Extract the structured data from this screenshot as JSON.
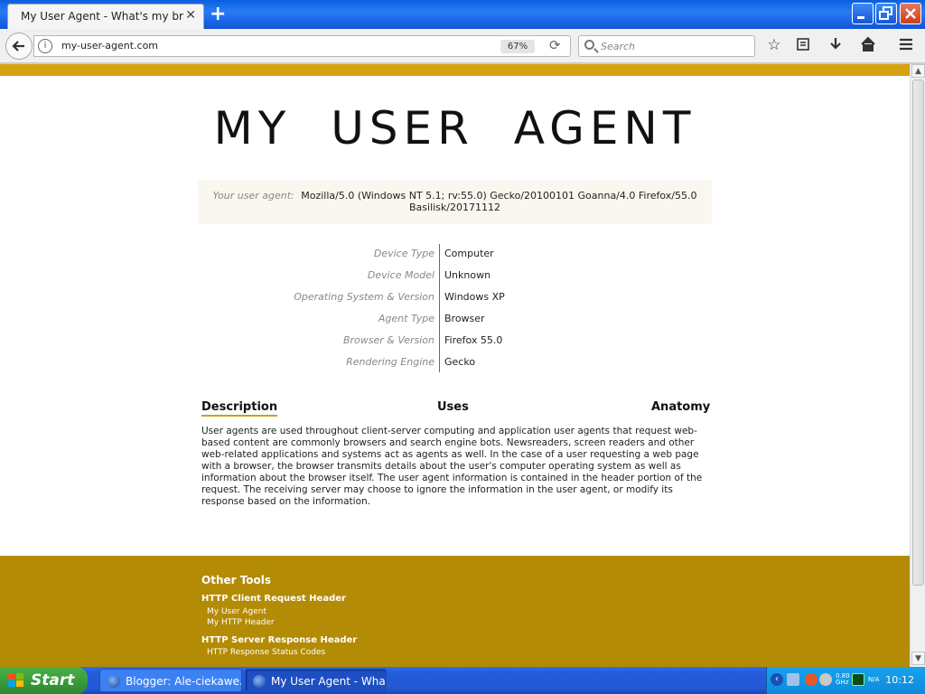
{
  "browser": {
    "tab_title": "My User Agent - What's my browser?",
    "tab_close": "✕",
    "new_tab": "+",
    "url": "my-user-agent.com",
    "zoom": "67%",
    "search_placeholder": "Search"
  },
  "page": {
    "title": "MY USER AGENT",
    "ua_label": "Your user agent:",
    "ua_value": "Mozilla/5.0 (Windows NT 5.1; rv:55.0) Gecko/20100101 Goanna/4.0 Firefox/55.0 Basilisk/20171112",
    "info": [
      {
        "key": "Device Type",
        "value": "Computer"
      },
      {
        "key": "Device Model",
        "value": "Unknown"
      },
      {
        "key": "Operating System & Version",
        "value": "Windows XP"
      },
      {
        "key": "Agent Type",
        "value": "Browser"
      },
      {
        "key": "Browser & Version",
        "value": "Firefox 55.0"
      },
      {
        "key": "Rendering Engine",
        "value": "Gecko"
      }
    ],
    "tabs": {
      "description": "Description",
      "uses": "Uses",
      "anatomy": "Anatomy"
    },
    "description": "User agents are used throughout client-server computing and application user agents that request web-based content are commonly browsers and search engine bots. Newsreaders, screen readers and other web-related applications and systems act as agents as well. In the case of a user requesting a web page with a browser, the browser transmits details about the user's computer operating system as well as information about the browser itself. The user agent information is contained in the header portion of the request. The receiving server may choose to ignore the information in the user agent, or modify its response based on the information."
  },
  "footer": {
    "title": "Other Tools",
    "group1": "HTTP Client Request Header",
    "group1_links": [
      "My User Agent",
      "My HTTP Header"
    ],
    "group2": "HTTP Server Response Header",
    "group2_links": [
      "HTTP Response Status Codes"
    ]
  },
  "taskbar": {
    "start": "Start",
    "tasks": [
      "Blogger: Ale-ciekawe....",
      "My User Agent - Wha..."
    ],
    "cpu_label": "0.80\nGHz",
    "na_label": "N/A",
    "clock": "10:12"
  },
  "colors": {
    "accent": "#d4a30f",
    "footer": "#b48b05"
  }
}
